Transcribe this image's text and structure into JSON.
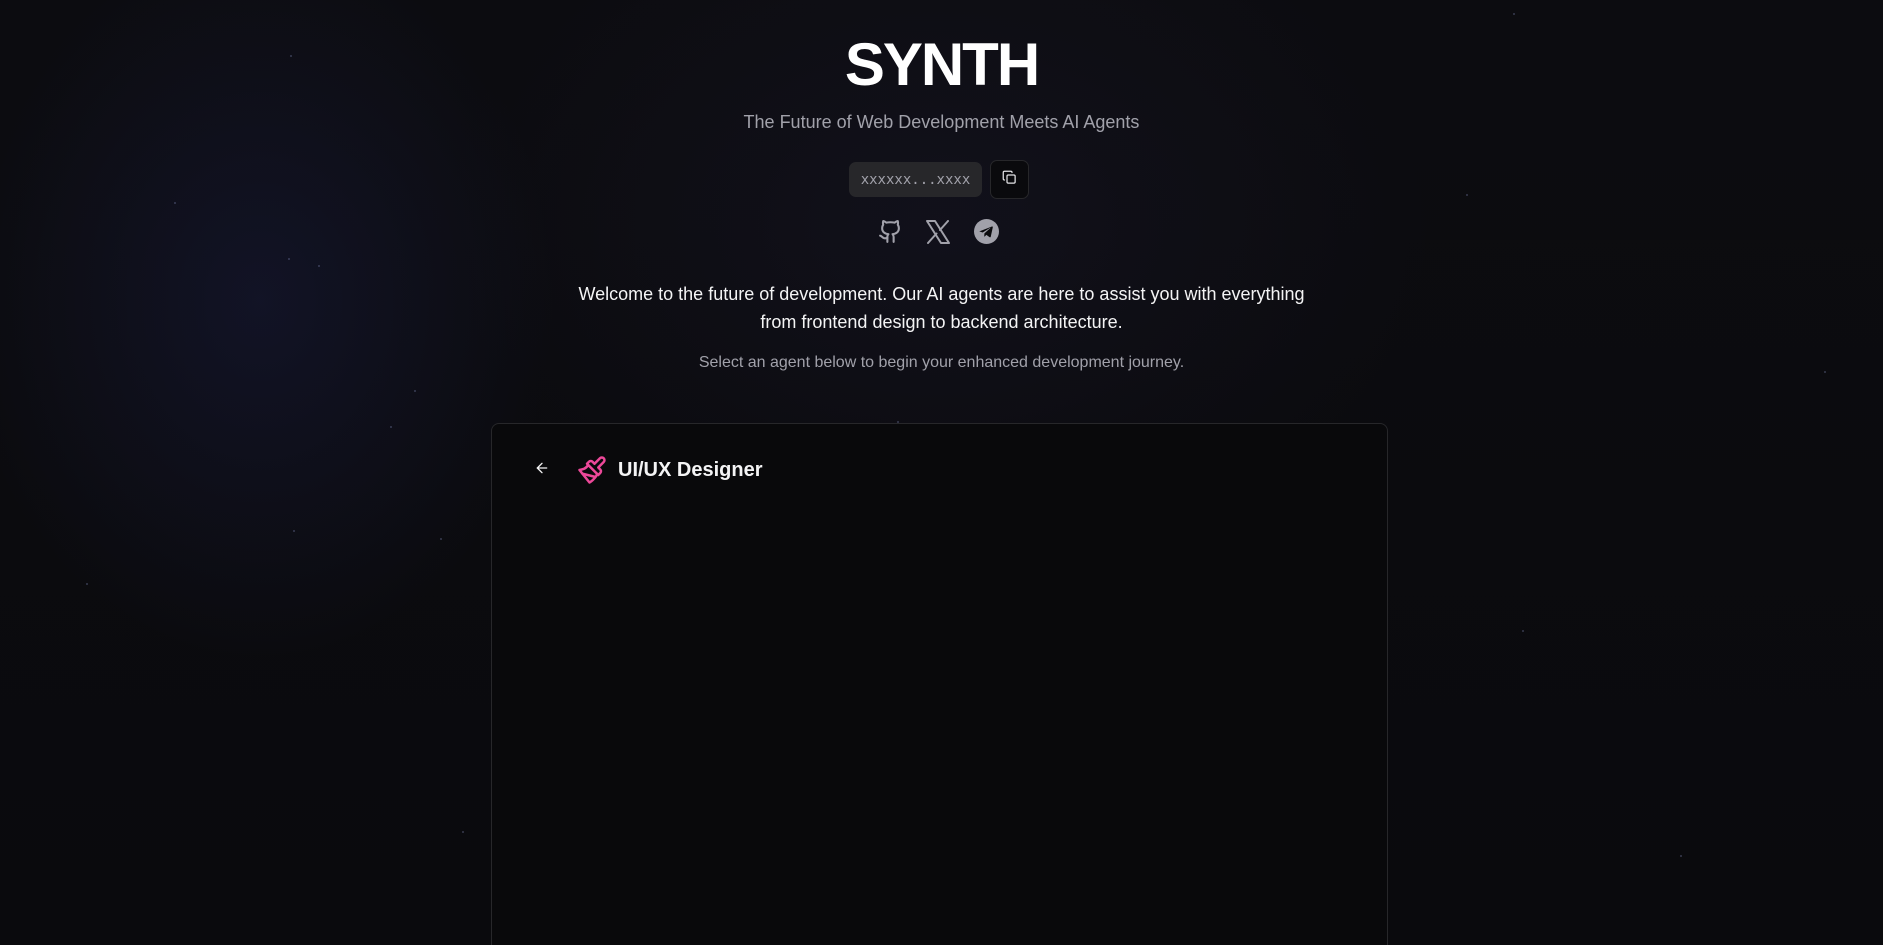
{
  "brand": {
    "logo": "SYNTH",
    "tagline": "The Future of Web Development Meets AI Agents"
  },
  "contract": {
    "address": "xxxxxx...xxxx",
    "copy_icon": "copy-icon"
  },
  "socials": [
    {
      "icon": "github-icon"
    },
    {
      "icon": "x-icon"
    },
    {
      "icon": "telegram-icon"
    }
  ],
  "intro": {
    "welcome": "Welcome to the future of development. Our AI agents are here to assist you with everything from frontend design to backend architecture.",
    "select": "Select an agent below to begin your enhanced development journey."
  },
  "agent_panel": {
    "back_icon": "arrow-left-icon",
    "agent_icon": "paintbrush-icon",
    "agent_name": "UI/UX Designer",
    "accent_color": "#ec4899"
  },
  "colors": {
    "background": "#0a0a0d",
    "muted_text": "#a1a1aa",
    "border": "#27272a"
  }
}
